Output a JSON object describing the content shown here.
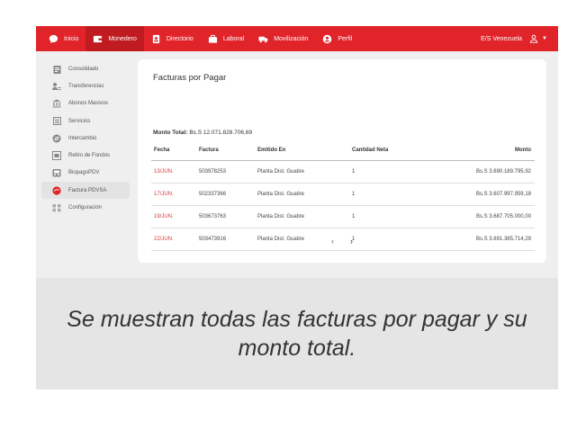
{
  "topbar": {
    "items": [
      {
        "label": "Inicio",
        "icon": "chat-bubble-icon"
      },
      {
        "label": "Monedero",
        "icon": "wallet-icon"
      },
      {
        "label": "Directorio",
        "icon": "contacts-icon"
      },
      {
        "label": "Laboral",
        "icon": "briefcase-icon"
      },
      {
        "label": "Movilización",
        "icon": "truck-icon"
      },
      {
        "label": "Perfil",
        "icon": "user-circle-icon"
      }
    ],
    "active_index": 1,
    "user_label": "E/S Venezuela",
    "accent": "#e0242a"
  },
  "sidebar": {
    "items": [
      {
        "label": "Consolidado",
        "icon": "clipboard-icon"
      },
      {
        "label": "Transferencias",
        "icon": "people-transfer-icon"
      },
      {
        "label": "Abonos Masivos",
        "icon": "bank-icon"
      },
      {
        "label": "Servicios",
        "icon": "list-icon"
      },
      {
        "label": "Intercambio",
        "icon": "exchange-icon"
      },
      {
        "label": "Retiro de Fondos",
        "icon": "withdraw-icon"
      },
      {
        "label": "BiopagoPDV",
        "icon": "fingerprint-terminal-icon"
      },
      {
        "label": "Factura PDVSA",
        "icon": "pdvsa-logo-icon"
      },
      {
        "label": "Configuración",
        "icon": "settings-icon"
      }
    ],
    "active_index": 7
  },
  "card": {
    "title": "Facturas por Pagar",
    "total_label": "Monto Total:",
    "total_value": "Bs.S 12.071.828.706,69",
    "columns": [
      "Fecha",
      "Factura",
      "Emitido En",
      "Cantidad Neta",
      "Monto"
    ],
    "rows": [
      {
        "fecha": "13/JUN.",
        "factura": "503978253",
        "emitido": "Planta Dist. Guatire",
        "cantidad": "1",
        "monto": "Bs.S 3.690.189.795,92"
      },
      {
        "fecha": "17/JUN.",
        "factura": "502337366",
        "emitido": "Planta Dist. Guatire",
        "cantidad": "1",
        "monto": "Bs.S 3.607.997.959,18"
      },
      {
        "fecha": "19/JUN.",
        "factura": "503673763",
        "emitido": "Planta Dist. Guatire",
        "cantidad": "1",
        "monto": "Bs.S 3.687.705.000,00"
      },
      {
        "fecha": "22/JUN.",
        "factura": "503473916",
        "emitido": "Planta Dist. Guatire",
        "cantidad": "1",
        "monto": "Bs.S 3.691.385.714,29"
      }
    ],
    "pager": {
      "prev": "‹",
      "next": "›"
    }
  },
  "caption": "Se muestran todas las facturas por pagar y su monto total."
}
